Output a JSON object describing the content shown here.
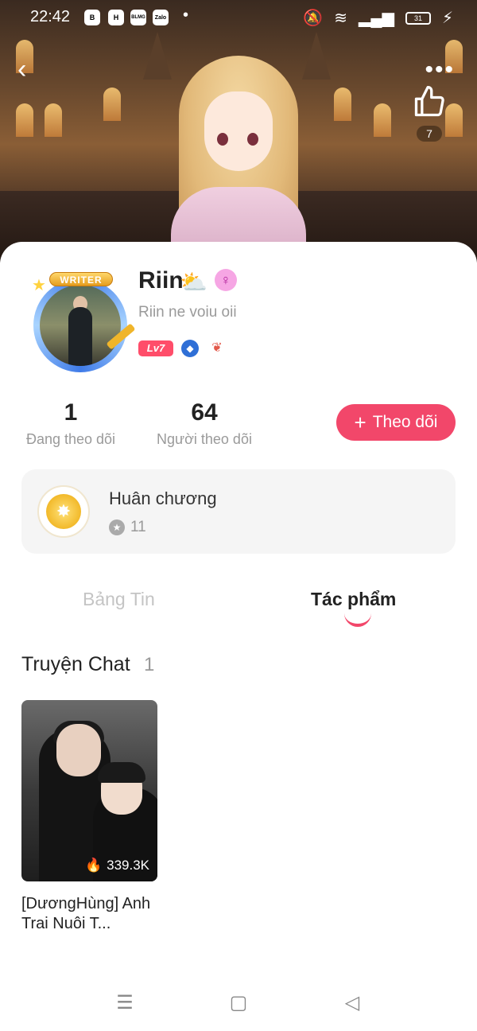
{
  "status_bar": {
    "time": "22:42",
    "apps": [
      "B",
      "H",
      "BLMG",
      "Zalo"
    ],
    "battery": "31"
  },
  "header": {
    "like_count": "7"
  },
  "profile": {
    "name": "Riin",
    "bio": "Riin ne voiu oii",
    "level": "Lv7",
    "writer_badge": "WRITER"
  },
  "stats": {
    "following_count": "1",
    "following_label": "Đang theo dõi",
    "followers_count": "64",
    "followers_label": "Người theo dõi"
  },
  "follow_button": {
    "label": "Theo dõi",
    "icon": "plus-icon"
  },
  "medals": {
    "title": "Huân chương",
    "count": "11"
  },
  "tabs": [
    {
      "label": "Bảng Tin",
      "active": false
    },
    {
      "label": "Tác phẩm",
      "active": true
    }
  ],
  "section": {
    "title": "Truyện Chat",
    "count": "1"
  },
  "works": [
    {
      "title": "[DươngHùng] Anh Trai Nuôi T...",
      "views": "339.3K"
    }
  ],
  "colors": {
    "accent": "#f2476a",
    "muted": "#9a9a9a"
  }
}
